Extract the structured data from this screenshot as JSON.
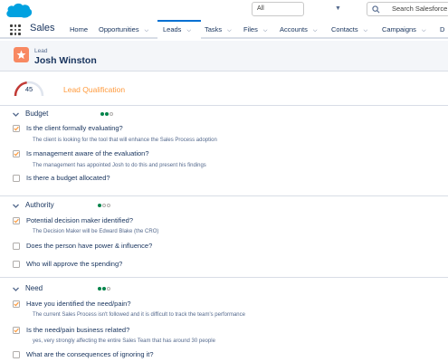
{
  "global_header": {
    "search_scope": "All",
    "search_placeholder": "Search Salesforce"
  },
  "nav": {
    "app_name": "Sales",
    "tabs": [
      {
        "label": "Home",
        "has_menu": false
      },
      {
        "label": "Opportunities",
        "has_menu": true
      },
      {
        "label": "Leads",
        "has_menu": true,
        "active": true
      },
      {
        "label": "Tasks",
        "has_menu": true
      },
      {
        "label": "Files",
        "has_menu": true
      },
      {
        "label": "Accounts",
        "has_menu": true
      },
      {
        "label": "Contacts",
        "has_menu": true
      },
      {
        "label": "Campaigns",
        "has_menu": true
      },
      {
        "label": "D",
        "has_menu": false
      }
    ]
  },
  "record": {
    "type_label": "Lead",
    "name": "Josh Winston"
  },
  "qualification": {
    "score": "45",
    "score_fraction": 0.45,
    "title": "Lead Qualification"
  },
  "sections": [
    {
      "title": "Budget",
      "dots_filled": 2,
      "dots_total": 3,
      "questions": [
        {
          "text": "Is the client formally evaluating?",
          "checked": true,
          "answer": "The client is looking for the tool that will enhance the Sales Process adoption"
        },
        {
          "text": "Is management aware of the evaluation?",
          "checked": true,
          "answer": "The management has appointed Josh to do this and present his findings"
        },
        {
          "text": "Is there a budget allocated?",
          "checked": false,
          "answer": ""
        }
      ]
    },
    {
      "title": "Authority",
      "dots_filled": 1,
      "dots_total": 3,
      "questions": [
        {
          "text": "Potential decision maker identified?",
          "checked": true,
          "answer": "The Decision Maker will be Edward Blake (the CRO)"
        },
        {
          "text": "Does the person have power & influence?",
          "checked": false,
          "answer": ""
        },
        {
          "text": "Who will approve the spending?",
          "checked": false,
          "answer": ""
        }
      ]
    },
    {
      "title": "Need",
      "dots_filled": 2,
      "dots_total": 3,
      "questions": [
        {
          "text": "Have you identified the need/pain?",
          "checked": true,
          "answer": "The current Sales Process isn't followed and it is difficult to track the team's performance"
        },
        {
          "text": "Is the need/pain business related?",
          "checked": true,
          "answer": "yes, very strongly affecting the entire Sales Team that has around 30 people"
        },
        {
          "text": "What are the consequences of ignoring it?",
          "checked": false,
          "answer": ""
        }
      ]
    }
  ],
  "colors": {
    "brand_blue": "#00a1e0",
    "active_tab": "#0070d2",
    "lead_icon": "#f88962",
    "accent_orange": "#ff9a3c",
    "dot_green": "#04844b",
    "check_orange": "#ff9a3c"
  }
}
